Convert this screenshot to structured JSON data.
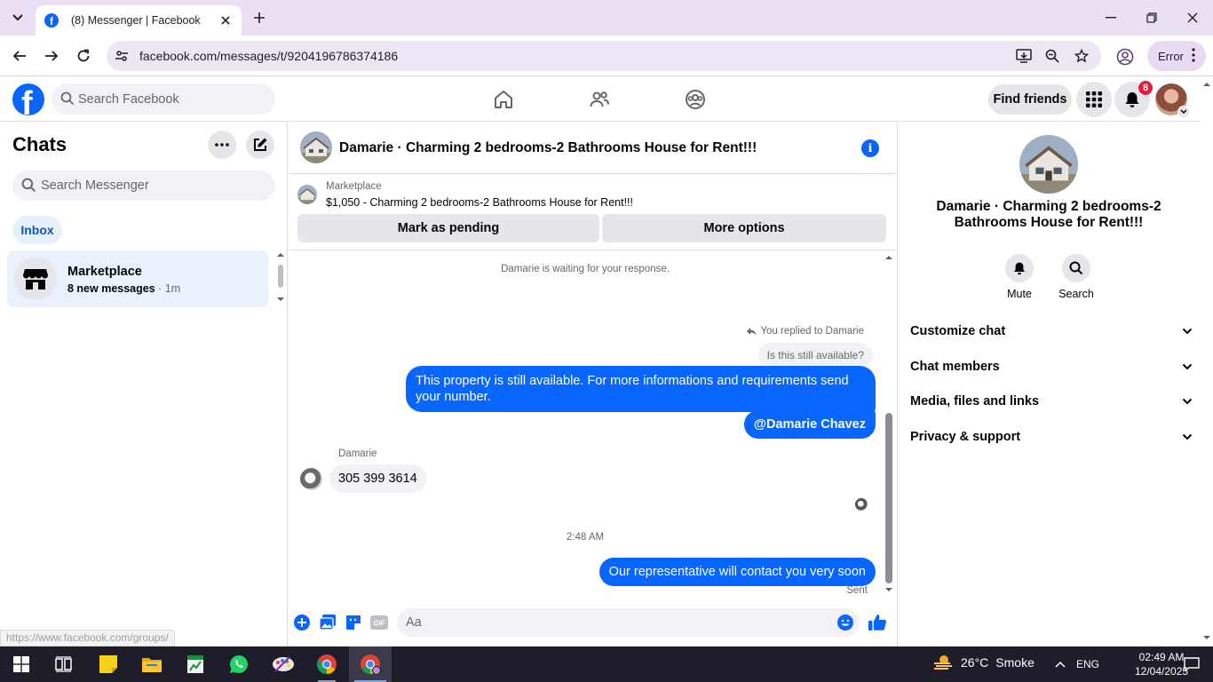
{
  "browser": {
    "tab_title": "(8) Messenger | Facebook",
    "url": "facebook.com/messages/t/9204196786374186",
    "profile_status": "Error",
    "status_url": "https://www.facebook.com/groups/"
  },
  "fb_header": {
    "search_placeholder": "Search Facebook",
    "find_friends": "Find friends",
    "notification_count": "8",
    "brand_color": "#0866ff"
  },
  "chats": {
    "title": "Chats",
    "search_placeholder": "Search Messenger",
    "filter_inbox": "Inbox",
    "items": [
      {
        "name": "Marketplace",
        "preview": "8 new messages",
        "separator": " · ",
        "time": "1m"
      }
    ]
  },
  "conversation": {
    "title": "Damarie · Charming 2 bedrooms-2 Bathrooms House for Rent!!!",
    "listing_label": "Marketplace",
    "listing_price_title": "$1,050 - Charming 2 bedrooms-2 Bathrooms House for Rent!!!",
    "mark_pending": "Mark as pending",
    "more_options": "More options",
    "waiting_notice": "Damarie is waiting for your response.",
    "replied_label": "You replied to Damarie",
    "quoted_message": "Is this still available?",
    "messages": [
      {
        "from": "me",
        "text": "This property is still available. For more informations and requirements send your number."
      },
      {
        "from": "me",
        "text": "@Damarie Chavez"
      },
      {
        "from": "Damarie",
        "sender_label": "Damarie",
        "text": "305 399 3614"
      },
      {
        "from": "me",
        "text": "Our representative will contact you very soon"
      }
    ],
    "timestamp": "2:48 AM",
    "status": "Sent",
    "composer_placeholder": "Aa"
  },
  "details": {
    "name": "Damarie · Charming 2 bedrooms-2 Bathrooms House for Rent!!!",
    "actions": [
      {
        "label": "Mute",
        "icon": "bell-icon"
      },
      {
        "label": "Search",
        "icon": "search-icon"
      }
    ],
    "sections": [
      "Customize chat",
      "Chat members",
      "Media, files and links",
      "Privacy & support"
    ]
  },
  "taskbar": {
    "temperature": "26°C",
    "weather": "Smoke",
    "language": "ENG",
    "time": "02:49 AM",
    "date": "12/04/2025"
  }
}
